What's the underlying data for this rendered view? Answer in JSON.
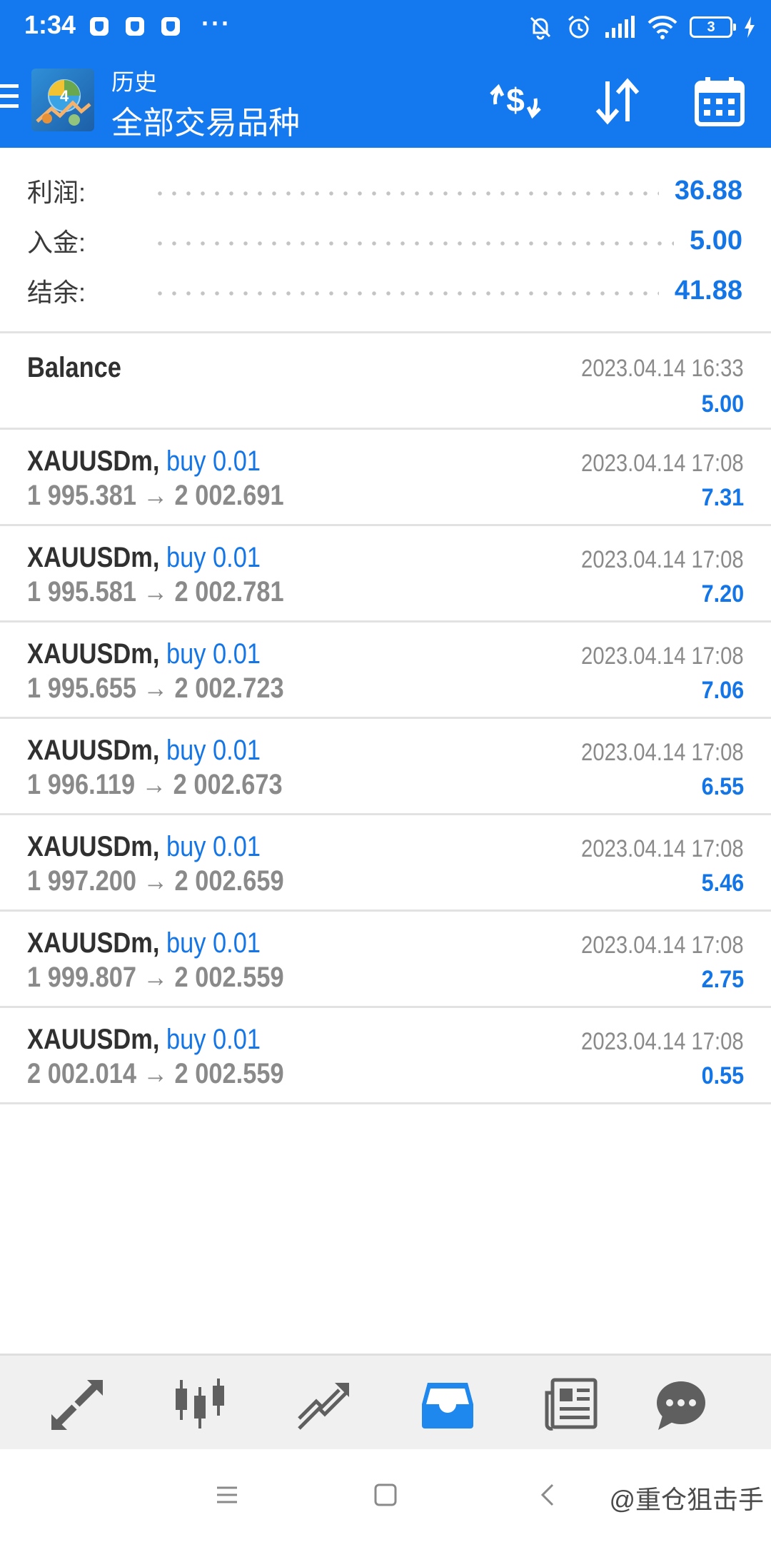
{
  "status_bar": {
    "time": "1:34",
    "more": "···",
    "battery": "3"
  },
  "app_bar": {
    "title": "历史",
    "subtitle": "全部交易品种"
  },
  "summary": [
    {
      "label": "利润:",
      "value": "36.88"
    },
    {
      "label": "入金:",
      "value": "5.00"
    },
    {
      "label": "结余:",
      "value": "41.88"
    }
  ],
  "balance_entry": {
    "label": "Balance",
    "time": "2023.04.14 16:33",
    "amount": "5.00"
  },
  "deals": [
    {
      "symbol": "XAUUSDm,",
      "side": "buy 0.01",
      "prices": "1 995.381 → 2 002.691",
      "time": "2023.04.14 17:08",
      "profit": "7.31"
    },
    {
      "symbol": "XAUUSDm,",
      "side": "buy 0.01",
      "prices": "1 995.581 → 2 002.781",
      "time": "2023.04.14 17:08",
      "profit": "7.20"
    },
    {
      "symbol": "XAUUSDm,",
      "side": "buy 0.01",
      "prices": "1 995.655 → 2 002.723",
      "time": "2023.04.14 17:08",
      "profit": "7.06"
    },
    {
      "symbol": "XAUUSDm,",
      "side": "buy 0.01",
      "prices": "1 996.119 → 2 002.673",
      "time": "2023.04.14 17:08",
      "profit": "6.55"
    },
    {
      "symbol": "XAUUSDm,",
      "side": "buy 0.01",
      "prices": "1 997.200 → 2 002.659",
      "time": "2023.04.14 17:08",
      "profit": "5.46"
    },
    {
      "symbol": "XAUUSDm,",
      "side": "buy 0.01",
      "prices": "1 999.807 → 2 002.559",
      "time": "2023.04.14 17:08",
      "profit": "2.75"
    },
    {
      "symbol": "XAUUSDm,",
      "side": "buy 0.01",
      "prices": "2 002.014 → 2 002.559",
      "time": "2023.04.14 17:08",
      "profit": "0.55"
    }
  ],
  "bottom_nav": [
    "quotes-icon",
    "chart-icon",
    "trade-icon",
    "history-icon",
    "news-icon",
    "chat-icon"
  ],
  "active_tab": "history-icon",
  "watermark": "@重仓狙击手",
  "colors": {
    "header": "#1479ee",
    "accent": "#1476e6",
    "text": "#303030",
    "muted": "#8a8a8a",
    "nav_bg": "#f0f0f0"
  }
}
